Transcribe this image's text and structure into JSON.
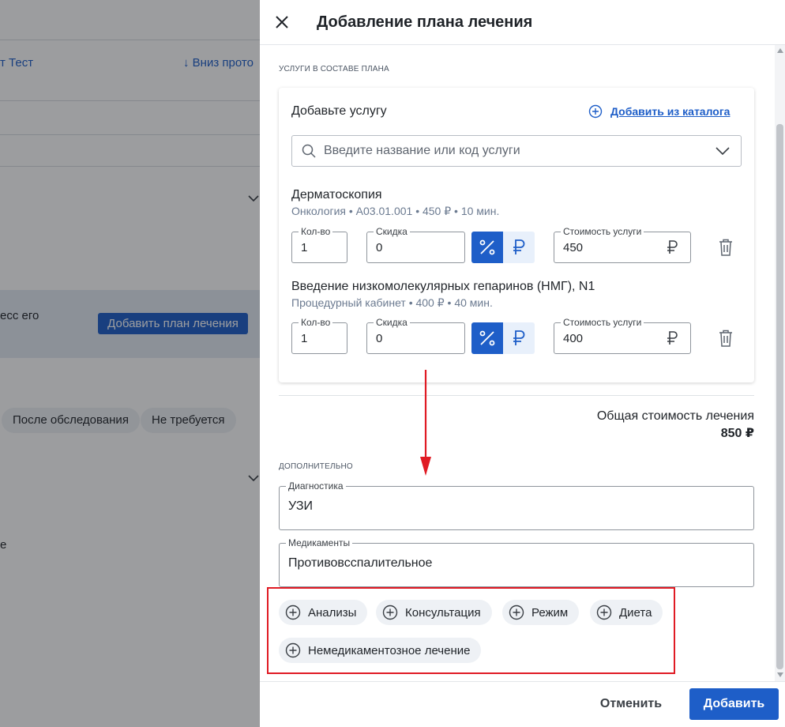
{
  "background": {
    "header_fragment": "т Тест",
    "download_fragment": "Вниз прото",
    "band_text_fragment": "есс его",
    "add_plan_button": "Добавить план лечения",
    "chip_after_exam": "После обследования",
    "chip_not_required": "Не требуется",
    "fragment_e": "е"
  },
  "drawer": {
    "title": "Добавление плана лечения",
    "services_section_label": "Услуги в составе плана",
    "card": {
      "heading": "Добавьте услугу",
      "catalog_link": "Добавить из каталога",
      "search_placeholder": "Введите название или код услуги"
    },
    "services": [
      {
        "name": "Дерматоскопия",
        "meta": "Онкология • А03.01.001 • 450 ₽ • 10 мин.",
        "qty_label": "Кол-во",
        "qty": "1",
        "discount_label": "Скидка",
        "discount": "0",
        "cost_label": "Стоимость услуги",
        "cost": "450"
      },
      {
        "name": "Введение низкомолекулярных гепаринов (НМГ), N1",
        "meta": "Процедурный кабинет • 400 ₽ • 40 мин.",
        "qty_label": "Кол-во",
        "qty": "1",
        "discount_label": "Скидка",
        "discount": "0",
        "cost_label": "Стоимость услуги",
        "cost": "400"
      }
    ],
    "total_label": "Общая стоимость лечения",
    "total_value": "850 ₽",
    "extra_section_label": "Дополнительно",
    "diagnostics_label": "Диагностика",
    "diagnostics_value": "УЗИ",
    "medications_label": "Медикаменты",
    "medications_value": "Противовсспалительное",
    "chips": [
      "Анализы",
      "Консультация",
      "Режим",
      "Диета",
      "Немедикаментозное лечение"
    ],
    "cancel_button": "Отменить",
    "add_button": "Добавить"
  },
  "colors": {
    "accent": "#1e5ec8",
    "annotation_red": "#e01b24",
    "chip_bg": "#eef1f5"
  }
}
